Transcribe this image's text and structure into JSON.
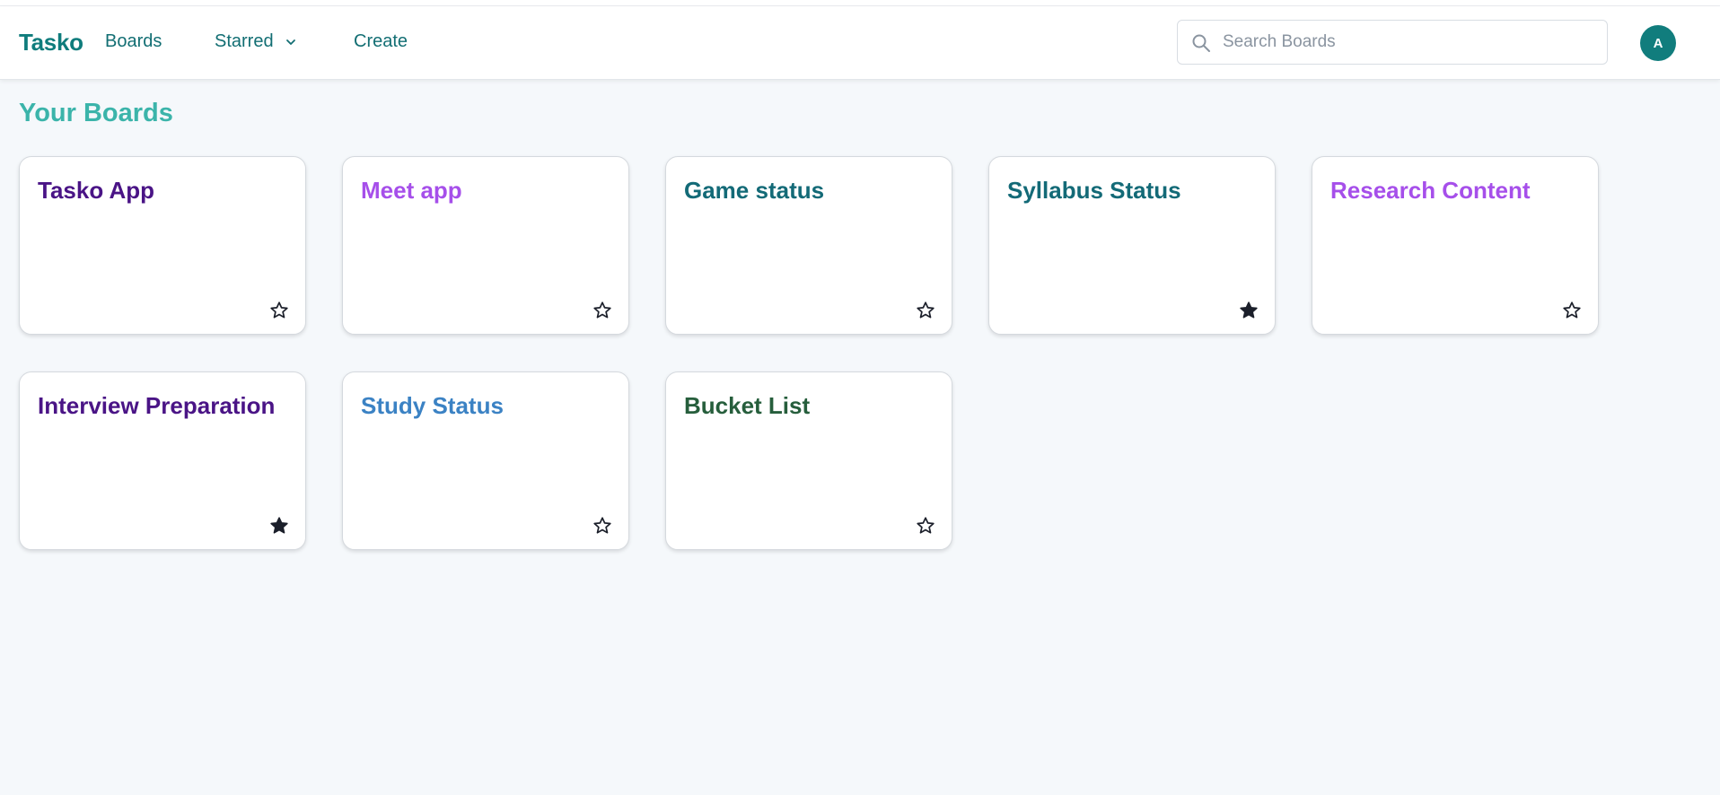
{
  "nav": {
    "brand": "Tasko",
    "boards_label": "Boards",
    "starred_label": "Starred",
    "create_label": "Create",
    "search_placeholder": "Search Boards",
    "avatar_initial": "A"
  },
  "page": {
    "title": "Your Boards"
  },
  "colors": {
    "brand": "#0f7c7c",
    "nav_link": "#126e73",
    "page_title": "#3bb4aa",
    "avatar_bg": "#117d7d",
    "star_filled": "#1b1f2a"
  },
  "boards": [
    {
      "title": "Tasko App",
      "color": "#4a1486",
      "starred": false
    },
    {
      "title": "Meet app",
      "color": "#a64fea",
      "starred": false
    },
    {
      "title": "Game status",
      "color": "#136a77",
      "starred": false
    },
    {
      "title": "Syllabus Status",
      "color": "#136a77",
      "starred": true
    },
    {
      "title": "Research Content",
      "color": "#a64fea",
      "starred": false
    },
    {
      "title": "Interview Preparation",
      "color": "#4a1486",
      "starred": true
    },
    {
      "title": "Study Status",
      "color": "#3b82c4",
      "starred": false
    },
    {
      "title": "Bucket List",
      "color": "#265e3c",
      "starred": false
    }
  ]
}
